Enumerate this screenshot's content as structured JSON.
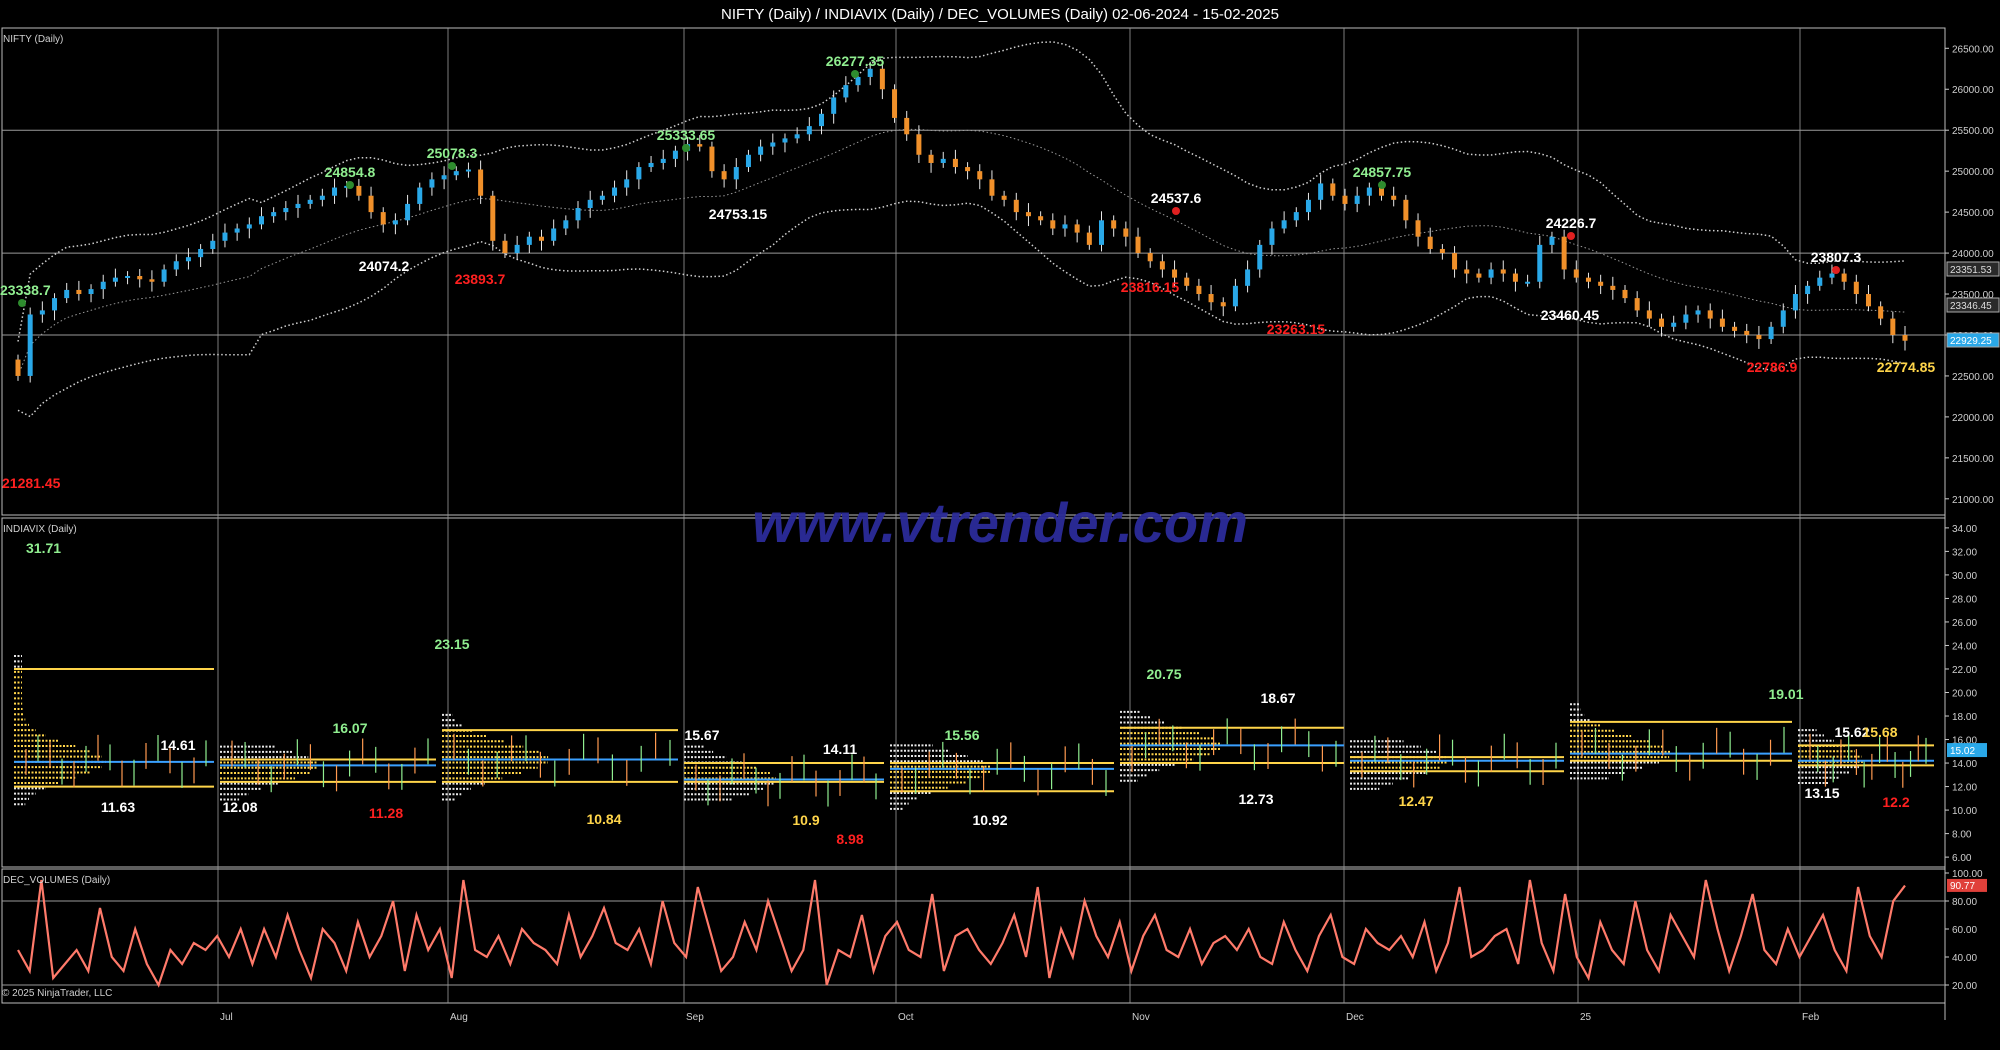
{
  "header": {
    "title": "NIFTY (Daily) / INDIAVIX (Daily) / DEC_VOLUMES (Daily)  02-06-2024 - 15-02-2025"
  },
  "watermark": "www.vtrender.com",
  "copyright": "© 2025 NinjaTrader, LLC",
  "colors": {
    "bull": "#29a8e8",
    "bear": "#f0902a",
    "grid": "#9a9a9a",
    "high": "#90ee90",
    "low_red": "#ff2020",
    "low_white": "#ffffff",
    "low_yellow": "#ffd54a",
    "band": "#d0d0d0",
    "vol_line": "#ff7a6a",
    "poc": "#3aa0ff",
    "va": "#ffd54a"
  },
  "chart_data": [
    {
      "name": "NIFTY (Daily)",
      "type": "line",
      "ylim": [
        20900,
        26650
      ],
      "yticks": [
        21000,
        21500,
        22000,
        22500,
        23000,
        23500,
        24000,
        24500,
        25000,
        25500,
        26000,
        26500
      ],
      "ytick_labels": [
        "21000.00",
        "21500.00",
        "22000.00",
        "22500.00",
        "23000.00",
        "23500.00",
        "24000.00",
        "24500.00",
        "25000.00",
        "25500.00",
        "26000.00",
        "26500.00"
      ],
      "current_value_labels": [
        "23351.53",
        "23346.45",
        "22929.25"
      ],
      "x_labels": [
        "Jul",
        "Aug",
        "Sep",
        "Oct",
        "Nov",
        "Dec",
        "25",
        "Feb"
      ],
      "closes": [
        22500,
        23250,
        23300,
        23450,
        23550,
        23500,
        23560,
        23650,
        23700,
        23720,
        23680,
        23650,
        23800,
        23900,
        23950,
        24050,
        24150,
        24250,
        24300,
        24350,
        24450,
        24500,
        24550,
        24600,
        24650,
        24700,
        24800,
        24820,
        24700,
        24500,
        24350,
        24400,
        24600,
        24800,
        24900,
        24950,
        25000,
        25020,
        24700,
        24150,
        24000,
        24100,
        24200,
        24150,
        24300,
        24400,
        24550,
        24650,
        24700,
        24800,
        24900,
        25050,
        25100,
        25150,
        25250,
        25330,
        25300,
        25000,
        24900,
        25050,
        25200,
        25300,
        25350,
        25400,
        25450,
        25550,
        25700,
        25900,
        26050,
        26150,
        26250,
        26000,
        25650,
        25450,
        25200,
        25100,
        25150,
        25050,
        25000,
        24900,
        24700,
        24650,
        24500,
        24450,
        24400,
        24300,
        24350,
        24250,
        24100,
        24400,
        24300,
        24200,
        24000,
        23900,
        23800,
        23700,
        23600,
        23500,
        23400,
        23350,
        23600,
        23800,
        24100,
        24300,
        24400,
        24500,
        24650,
        24850,
        24700,
        24600,
        24700,
        24800,
        24700,
        24650,
        24400,
        24200,
        24050,
        24000,
        23800,
        23750,
        23700,
        23800,
        23750,
        23650,
        23650,
        24100,
        24200,
        23800,
        23700,
        23650,
        23600,
        23550,
        23450,
        23300,
        23200,
        23100,
        23150,
        23250,
        23300,
        23200,
        23100,
        23050,
        23000,
        22950,
        23100,
        23300,
        23500,
        23600,
        23700,
        23750,
        23650,
        23500,
        23350,
        23200,
        23000,
        22930
      ],
      "highs_marked": [
        "23338.7",
        "24854.8",
        "25078.3",
        "25333.65",
        "26277.35",
        "24537.6",
        "24857.75",
        "24226.7",
        "23807.3"
      ],
      "lows_marked": [
        "21281.45",
        "24074.2",
        "23893.7",
        "24753.15",
        "23816.15",
        "23263.15",
        "23460.45",
        "22786.9",
        "22774.85"
      ]
    },
    {
      "name": "INDIAVIX (Daily)",
      "type": "line",
      "ylim": [
        5.5,
        34.5
      ],
      "yticks": [
        6,
        8,
        10,
        12,
        14,
        16,
        18,
        20,
        22,
        24,
        26,
        28,
        30,
        32,
        34
      ],
      "ytick_labels": [
        "6.00",
        "8.00",
        "10.00",
        "12.00",
        "14.00",
        "16.00",
        "18.00",
        "20.00",
        "22.00",
        "24.00",
        "26.00",
        "28.00",
        "30.00",
        "32.00",
        "34.00"
      ],
      "current_value_label": "15.02",
      "annotations": [
        "31.71",
        "14.61",
        "11.63",
        "12.08",
        "16.07",
        "11.28",
        "23.15",
        "10.84",
        "15.67",
        "14.11",
        "10.9",
        "8.98",
        "15.56",
        "10.92",
        "20.75",
        "18.67",
        "12.73",
        "12.47",
        "19.01",
        "15.62",
        "15.68",
        "13.15",
        "12.2"
      ],
      "profile_months": [
        {
          "poc": 14.1,
          "vah": 22.0,
          "val": 12.0
        },
        {
          "poc": 13.8,
          "vah": 14.3,
          "val": 12.4
        },
        {
          "poc": 14.3,
          "vah": 16.8,
          "val": 12.4
        },
        {
          "poc": 12.6,
          "vah": 14.0,
          "val": 12.4
        },
        {
          "poc": 13.5,
          "vah": 14.0,
          "val": 11.6
        },
        {
          "poc": 15.5,
          "vah": 17.0,
          "val": 14.0
        },
        {
          "poc": 14.2,
          "vah": 14.5,
          "val": 13.3
        },
        {
          "poc": 14.8,
          "vah": 17.5,
          "val": 14.2
        },
        {
          "poc": 14.2,
          "vah": 15.5,
          "val": 13.8
        }
      ]
    },
    {
      "name": "DEC_VOLUMES (Daily)",
      "type": "line",
      "ylim": [
        10,
        100
      ],
      "yticks": [
        20,
        40,
        60,
        80,
        100
      ],
      "ytick_labels": [
        "20.00",
        "40.00",
        "60.00",
        "80.00",
        "100.00"
      ],
      "current_value_label": "90.77",
      "values": [
        45,
        30,
        95,
        25,
        35,
        45,
        30,
        75,
        40,
        30,
        60,
        35,
        20,
        45,
        35,
        50,
        45,
        55,
        40,
        60,
        35,
        60,
        40,
        70,
        45,
        25,
        60,
        50,
        30,
        65,
        40,
        55,
        80,
        30,
        70,
        45,
        60,
        25,
        95,
        45,
        40,
        55,
        35,
        60,
        50,
        45,
        35,
        70,
        40,
        55,
        75,
        50,
        45,
        60,
        35,
        80,
        50,
        40,
        90,
        60,
        30,
        40,
        65,
        45,
        80,
        55,
        30,
        45,
        95,
        20,
        45,
        40,
        70,
        30,
        55,
        65,
        45,
        40,
        85,
        30,
        55,
        60,
        45,
        35,
        50,
        70,
        40,
        90,
        25,
        60,
        40,
        80,
        55,
        40,
        65,
        30,
        55,
        70,
        45,
        40,
        60,
        35,
        50,
        55,
        45,
        60,
        40,
        35,
        65,
        45,
        30,
        55,
        70,
        40,
        35,
        60,
        50,
        45,
        55,
        40,
        65,
        30,
        50,
        90,
        40,
        45,
        55,
        60,
        35,
        95,
        50,
        30,
        85,
        40,
        25,
        65,
        45,
        35,
        80,
        45,
        30,
        70,
        55,
        40,
        95,
        60,
        30,
        55,
        85,
        45,
        35,
        60,
        40,
        55,
        70,
        45,
        30,
        90,
        55,
        40,
        80,
        91
      ]
    }
  ]
}
